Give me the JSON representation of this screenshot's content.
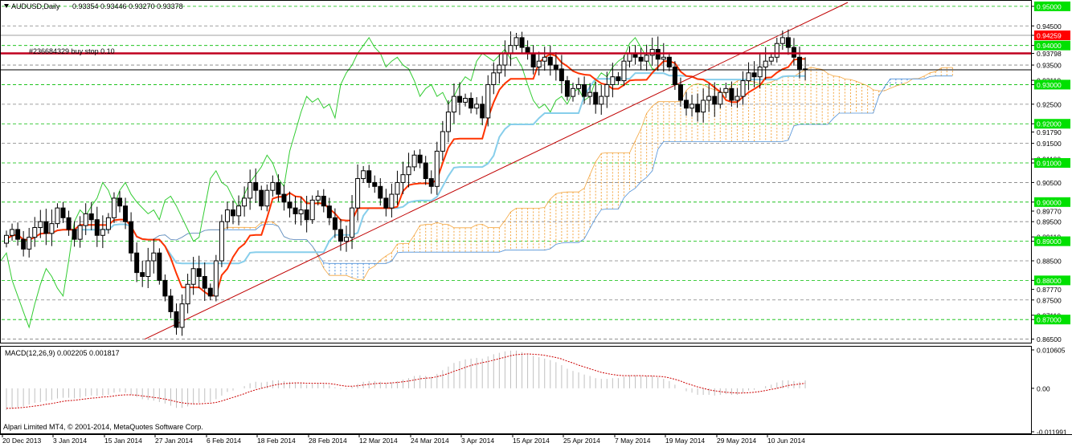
{
  "window": {
    "symbol": "AUDUSD,Daily",
    "ohlc": "0.93354 0.93446 0.93270 0.93378",
    "dropdown_icon": "triangle-down-icon"
  },
  "order_label": "#236684329 buy stop 0.10",
  "indicator_label": "MACD(12,26,9) 0.002205 0.001817",
  "copyright": "Alpari Limited MT4, © 2001-2014, MetaQuotes Software Corp.",
  "colors": {
    "price_line_red": "#ff0000",
    "order_line": "#c0001e",
    "tenkan": "#ff3300",
    "kijun": "#87ceeb",
    "chikou": "#33cc33",
    "cloud_bull": "#f4a640",
    "cloud_bear": "#4f90d8",
    "macd_signal": "#cc0000",
    "macd_hist": "#c0c0c0",
    "grid_green": "#00bb00",
    "grid_gray": "#808080",
    "trendline": "#c00000"
  },
  "chart_data": [
    {
      "type": "candlestick",
      "title": "AUDUSD,Daily",
      "ylim": [
        0.8645,
        0.951
      ],
      "price_axis_labels": [
        {
          "text": "0.95000",
          "value": 0.95,
          "style": "green"
        },
        {
          "text": "0.94500",
          "value": 0.945,
          "style": "plain"
        },
        {
          "text": "0.94259",
          "value": 0.94259,
          "style": "red"
        },
        {
          "text": "0.94000",
          "value": 0.94,
          "style": "green"
        },
        {
          "text": "0.93798",
          "value": 0.93798,
          "style": "plain"
        },
        {
          "text": "0.93500",
          "value": 0.935,
          "style": "plain"
        },
        {
          "text": "0.93110",
          "value": 0.9311,
          "style": "plain"
        },
        {
          "text": "0.93000",
          "value": 0.93,
          "style": "green"
        },
        {
          "text": "0.92500",
          "value": 0.925,
          "style": "plain"
        },
        {
          "text": "0.92000",
          "value": 0.92,
          "style": "green"
        },
        {
          "text": "0.91790",
          "value": 0.9179,
          "style": "plain"
        },
        {
          "text": "0.91500",
          "value": 0.915,
          "style": "plain"
        },
        {
          "text": "0.91100",
          "value": 0.911,
          "style": "plain"
        },
        {
          "text": "0.91000",
          "value": 0.91,
          "style": "green"
        },
        {
          "text": "0.90500",
          "value": 0.905,
          "style": "plain"
        },
        {
          "text": "0.90000",
          "value": 0.9,
          "style": "green"
        },
        {
          "text": "0.89770",
          "value": 0.8977,
          "style": "plain"
        },
        {
          "text": "0.89500",
          "value": 0.895,
          "style": "plain"
        },
        {
          "text": "0.89110",
          "value": 0.8911,
          "style": "plain"
        },
        {
          "text": "0.89000",
          "value": 0.89,
          "style": "green"
        },
        {
          "text": "0.88500",
          "value": 0.885,
          "style": "plain"
        },
        {
          "text": "0.88000",
          "value": 0.88,
          "style": "green"
        },
        {
          "text": "0.87770",
          "value": 0.8777,
          "style": "plain"
        },
        {
          "text": "0.87500",
          "value": 0.875,
          "style": "plain"
        },
        {
          "text": "0.87110",
          "value": 0.8711,
          "style": "plain"
        },
        {
          "text": "0.87000",
          "value": 0.87,
          "style": "green"
        },
        {
          "text": "0.86500",
          "value": 0.865,
          "style": "plain"
        }
      ],
      "gridline_levels": [
        0.95,
        0.945,
        0.94,
        0.935,
        0.93,
        0.925,
        0.92,
        0.915,
        0.91,
        0.905,
        0.9,
        0.895,
        0.89,
        0.885,
        0.88,
        0.875,
        0.87,
        0.865
      ],
      "green_levels": [
        0.95,
        0.94,
        0.93,
        0.92,
        0.91,
        0.9,
        0.89,
        0.88,
        0.87
      ],
      "order_level": 0.93798,
      "current_price": 0.93378,
      "x_labels": [
        "20 Dec 2013",
        "3 Jan 2014",
        "15 Jan 2014",
        "27 Jan 2014",
        "6 Feb 2014",
        "18 Feb 2014",
        "28 Feb 2014",
        "12 Mar 2014",
        "24 Mar 2014",
        "3 Apr 2014",
        "15 Apr 2014",
        "25 Apr 2014",
        "7 May 2014",
        "19 May 2014",
        "29 May 2014",
        "10 Jun 2014"
      ],
      "closes": [
        0.8915,
        0.893,
        0.8905,
        0.888,
        0.891,
        0.8935,
        0.895,
        0.892,
        0.8945,
        0.8985,
        0.896,
        0.893,
        0.8905,
        0.894,
        0.897,
        0.8955,
        0.8915,
        0.893,
        0.896,
        0.901,
        0.899,
        0.895,
        0.887,
        0.882,
        0.881,
        0.885,
        0.887,
        0.88,
        0.876,
        0.872,
        0.868,
        0.874,
        0.879,
        0.883,
        0.881,
        0.878,
        0.876,
        0.885,
        0.895,
        0.898,
        0.8965,
        0.899,
        0.901,
        0.905,
        0.903,
        0.899,
        0.903,
        0.905,
        0.902,
        0.9,
        0.8985,
        0.897,
        0.898,
        0.8955,
        0.9005,
        0.9015,
        0.899,
        0.896,
        0.893,
        0.89,
        0.891,
        0.8985,
        0.906,
        0.908,
        0.905,
        0.904,
        0.901,
        0.8985,
        0.902,
        0.905,
        0.907,
        0.909,
        0.912,
        0.91,
        0.906,
        0.904,
        0.913,
        0.918,
        0.923,
        0.927,
        0.9255,
        0.9265,
        0.924,
        0.925,
        0.9215,
        0.93,
        0.933,
        0.935,
        0.938,
        0.94,
        0.942,
        0.9395,
        0.938,
        0.9345,
        0.936,
        0.937,
        0.935,
        0.934,
        0.931,
        0.927,
        0.929,
        0.93,
        0.927,
        0.928,
        0.925,
        0.927,
        0.93,
        0.932,
        0.931,
        0.936,
        0.938,
        0.937,
        0.936,
        0.9375,
        0.939,
        0.9365,
        0.937,
        0.9345,
        0.93,
        0.926,
        0.924,
        0.925,
        0.923,
        0.926,
        0.927,
        0.925,
        0.928,
        0.929,
        0.926,
        0.927,
        0.931,
        0.933,
        0.932,
        0.9345,
        0.936,
        0.937,
        0.9405,
        0.942,
        0.9395,
        0.937,
        0.934,
        0.9338
      ],
      "series": [
        {
          "name": "MACD(12,26,9) main",
          "kind": "histogram"
        },
        {
          "name": "MACD(12,26,9) signal",
          "kind": "line"
        }
      ],
      "macd_axis_labels": [
        {
          "text": "0.010605",
          "value": 0.010605
        },
        {
          "text": "0.00",
          "value": 0.0
        },
        {
          "text": "-0.011991",
          "value": -0.011991
        }
      ],
      "macd_hist": [
        -0.006,
        -0.0055,
        -0.0052,
        -0.005,
        -0.0045,
        -0.004,
        -0.0038,
        -0.0035,
        -0.0032,
        -0.0028,
        -0.0026,
        -0.0026,
        -0.0028,
        -0.0026,
        -0.0022,
        -0.002,
        -0.0021,
        -0.002,
        -0.0018,
        -0.0012,
        -0.001,
        -0.0012,
        -0.0018,
        -0.0024,
        -0.003,
        -0.0032,
        -0.0034,
        -0.0038,
        -0.0042,
        -0.0048,
        -0.0054,
        -0.0054,
        -0.005,
        -0.0044,
        -0.004,
        -0.0038,
        -0.0038,
        -0.003,
        -0.002,
        -0.001,
        -0.0006,
        0.0,
        0.0006,
        0.0014,
        0.0018,
        0.0016,
        0.0018,
        0.0022,
        0.0022,
        0.002,
        0.0018,
        0.0016,
        0.0014,
        0.001,
        0.0012,
        0.0014,
        0.0012,
        0.0008,
        0.0003,
        -0.0002,
        -0.0002,
        0.0004,
        0.0012,
        0.0018,
        0.002,
        0.002,
        0.0018,
        0.0014,
        0.0016,
        0.002,
        0.0024,
        0.0028,
        0.0034,
        0.0036,
        0.0034,
        0.0032,
        0.004,
        0.005,
        0.006,
        0.007,
        0.0075,
        0.008,
        0.0082,
        0.0084,
        0.0082,
        0.0088,
        0.0094,
        0.0098,
        0.0102,
        0.0104,
        0.0104,
        0.01,
        0.0096,
        0.009,
        0.0086,
        0.0082,
        0.0078,
        0.0072,
        0.0064,
        0.0054,
        0.0048,
        0.0044,
        0.0038,
        0.0034,
        0.0028,
        0.0026,
        0.0026,
        0.0028,
        0.0028,
        0.0032,
        0.0036,
        0.0036,
        0.0034,
        0.0034,
        0.0034,
        0.003,
        0.0026,
        0.002,
        0.001,
        0.0,
        -0.0008,
        -0.0012,
        -0.0018,
        -0.0018,
        -0.0018,
        -0.002,
        -0.0018,
        -0.0016,
        -0.0018,
        -0.0018,
        -0.0012,
        -0.0006,
        -0.0004,
        0.0,
        0.0006,
        0.001,
        0.0016,
        0.0022,
        0.0022,
        0.002,
        0.0018,
        0.0022
      ],
      "macd_signal": [
        -0.0055,
        -0.0055,
        -0.0054,
        -0.0053,
        -0.0051,
        -0.0049,
        -0.0047,
        -0.0044,
        -0.0042,
        -0.0039,
        -0.0036,
        -0.0034,
        -0.0033,
        -0.0031,
        -0.0029,
        -0.0027,
        -0.0026,
        -0.0024,
        -0.0023,
        -0.0021,
        -0.0019,
        -0.0018,
        -0.0018,
        -0.0019,
        -0.0021,
        -0.0023,
        -0.0025,
        -0.0027,
        -0.003,
        -0.0033,
        -0.0037,
        -0.004,
        -0.0042,
        -0.0043,
        -0.0043,
        -0.0042,
        -0.0041,
        -0.0039,
        -0.0035,
        -0.003,
        -0.0025,
        -0.002,
        -0.0015,
        -0.0009,
        -0.0004,
        0.0,
        0.0004,
        0.0008,
        0.0011,
        0.0013,
        0.0014,
        0.0015,
        0.0015,
        0.0014,
        0.0014,
        0.0014,
        0.0014,
        0.0013,
        0.0011,
        0.0008,
        0.0006,
        0.0006,
        0.0007,
        0.0009,
        0.0011,
        0.0013,
        0.0014,
        0.0014,
        0.0015,
        0.0016,
        0.0018,
        0.002,
        0.0023,
        0.0026,
        0.0028,
        0.0029,
        0.0032,
        0.0036,
        0.0041,
        0.0047,
        0.0052,
        0.0058,
        0.0063,
        0.0067,
        0.0071,
        0.0074,
        0.0078,
        0.0082,
        0.0086,
        0.009,
        0.0093,
        0.0094,
        0.0095,
        0.0094,
        0.0093,
        0.0091,
        0.0088,
        0.0085,
        0.0081,
        0.0075,
        0.007,
        0.0064,
        0.0059,
        0.0054,
        0.0049,
        0.0044,
        0.0041,
        0.0038,
        0.0036,
        0.0035,
        0.0035,
        0.0035,
        0.0035,
        0.0034,
        0.0034,
        0.0033,
        0.0032,
        0.0029,
        0.0025,
        0.002,
        0.0014,
        0.0009,
        0.0004,
        0.0,
        -0.0004,
        -0.0007,
        -0.0009,
        -0.0011,
        -0.0012,
        -0.0013,
        -0.0013,
        -0.0012,
        -0.0011,
        -0.0009,
        -0.0006,
        -0.0003,
        0.0,
        0.0004,
        0.0008,
        0.001,
        0.0012,
        0.0014
      ]
    }
  ]
}
